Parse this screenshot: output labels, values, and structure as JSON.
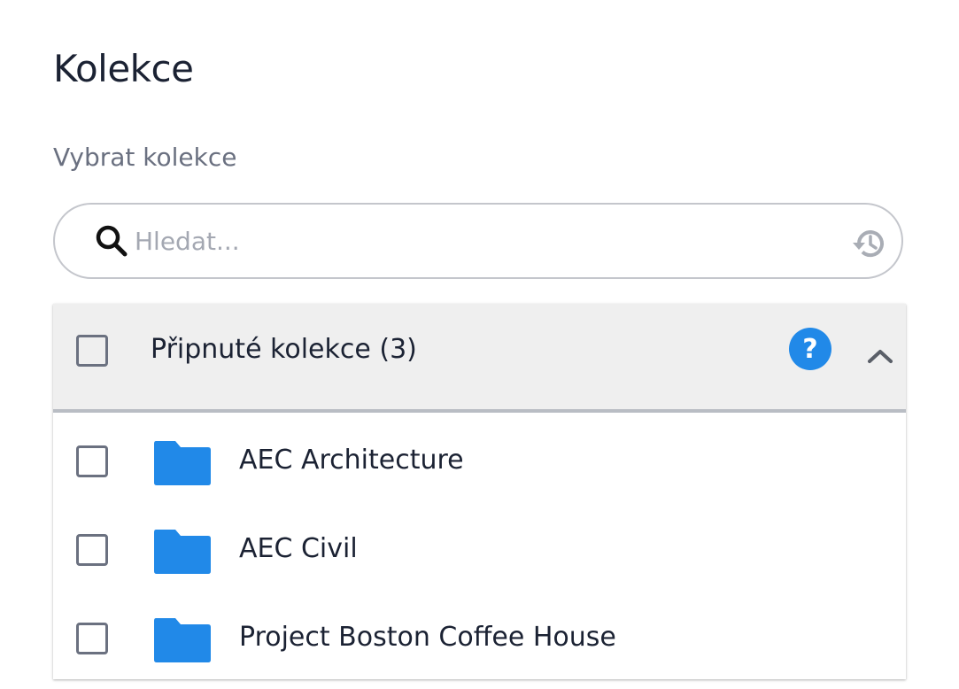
{
  "page": {
    "title": "Kolekce",
    "select_label": "Vybrat kolekce"
  },
  "search": {
    "placeholder": "Hledat...",
    "value": "",
    "icons": [
      "search-icon",
      "history-icon"
    ]
  },
  "pinned": {
    "header_label": "Připnuté kolekce (3)",
    "checked": false,
    "expanded": true,
    "icons": [
      "help-icon",
      "chevron-up-icon"
    ],
    "items": [
      {
        "label": "AEC Architecture",
        "checked": false,
        "icon": "folder-icon"
      },
      {
        "label": "AEC Civil",
        "checked": false,
        "icon": "folder-icon"
      },
      {
        "label": "Project Boston Coffee House",
        "checked": false,
        "icon": "folder-icon"
      }
    ]
  },
  "colors": {
    "accent": "#2189e8",
    "folder": "#2189e8",
    "text": "#1b2233",
    "muted": "#6a7080",
    "header_bg": "#efefef"
  }
}
